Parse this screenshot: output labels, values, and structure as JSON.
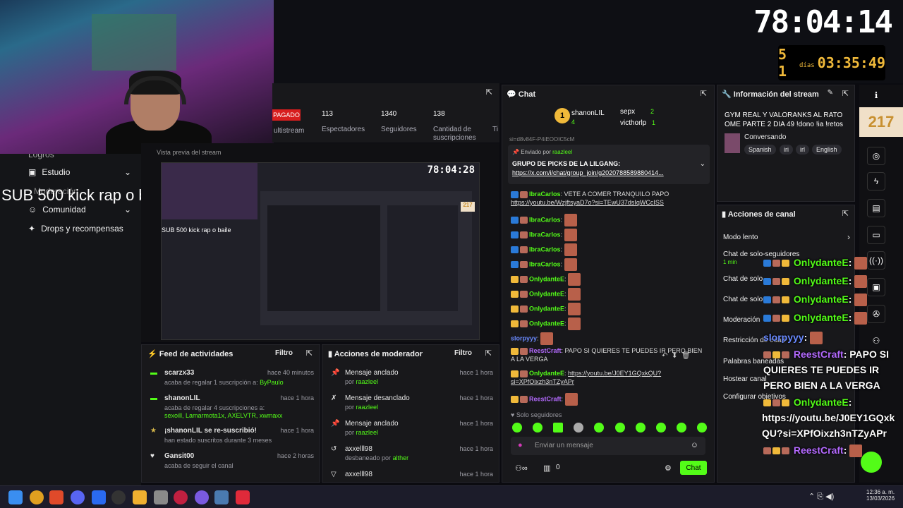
{
  "overlay": {
    "big_timer": "78:04:14",
    "days_number": "5 1",
    "days_label": "días",
    "day_timer": "03:35:49",
    "sub_count": "217",
    "sub_goal_text": "SUB 500 kick  rap o  baile"
  },
  "nav": {
    "items": [
      {
        "label": "Logros"
      },
      {
        "label": "Estudio"
      },
      {
        "label": "Moderación"
      },
      {
        "label": "Comunidad"
      },
      {
        "label": "Drops y recompensas"
      }
    ],
    "preview_label": "Vista previa del stream"
  },
  "stats": {
    "paid_badge": "PAGADO",
    "multistream": "ultistream",
    "viewers_value": "113",
    "viewers_label": "Espectadores",
    "followers_value": "1340",
    "followers_label": "Seguidores",
    "subs_value": "138",
    "subs_label": "Cantidad de suscripciones",
    "ti_label": "Ti"
  },
  "preview": {
    "timer": "78:04:28",
    "sub_text": "SUB 500 kick  rap o  baile"
  },
  "feed": {
    "title": "Feed de actividades",
    "filter": "Filtro",
    "rows": [
      {
        "user": "scarzx33",
        "time": "hace 40 minutos",
        "line": "acaba de regalar 1 suscripción a:",
        "extra": "ByPaulo"
      },
      {
        "user": "shanonLIL",
        "time": "hace 1 hora",
        "line": "acaba de regalar 4 suscripciones a:",
        "extra": "sexoill, Lamarmota1x, AXELVTR, xwmaxx"
      },
      {
        "user": "¡shanonLIL se re-suscribió!",
        "time": "hace 1 hora",
        "line": "han estado suscritos durante 3 meses",
        "extra": ""
      },
      {
        "user": "Gansit00",
        "time": "hace 2 horas",
        "line": "acaba de seguir el canal",
        "extra": ""
      }
    ]
  },
  "modactions": {
    "title": "Acciones de moderador",
    "filter": "Filtro",
    "rows": [
      {
        "action": "Mensaje anclado",
        "by": "por",
        "mod": "raazleel",
        "time": "hace 1 hora"
      },
      {
        "action": "Mensaje desanclado",
        "by": "por",
        "mod": "raazleel",
        "time": "hace 1 hora"
      },
      {
        "action": "Mensaje anclado",
        "by": "por",
        "mod": "raazleel",
        "time": "hace 1 hora"
      },
      {
        "action": "axxelll98",
        "by": "desbaneado por",
        "mod": "alther",
        "time": "hace 1 hora"
      },
      {
        "action": "axxelll98",
        "by": "",
        "mod": "",
        "time": "hace 1 hora"
      }
    ]
  },
  "chat": {
    "title": "Chat",
    "top_users": [
      {
        "name": "shanonLIL",
        "count": "4"
      },
      {
        "name": "sepx",
        "count": "2"
      },
      {
        "name": "victhorlp",
        "count": "1"
      }
    ],
    "partial_top": "si=d8v84F-P4iEOOIC5cM",
    "pinned_by_label": "Enviado por",
    "pinned_by_user": "raazleel",
    "pinned_text": "GRUPO DE PICKS DE LA LILGANG:",
    "pinned_link": "https://x.com/i/chat/group_join/g2020788589880414...",
    "messages": [
      {
        "user": "IbraCarlos",
        "text": ": VETE A COMER TRANQUILO PAPO",
        "link": "https://youtu.be/WzjftsyaD7o?si=TEwU37dsIqWCcISS"
      },
      {
        "user": "IbraCarlos",
        "text": ":"
      },
      {
        "user": "IbraCarlos",
        "text": ":"
      },
      {
        "user": "IbraCarlos",
        "text": ":"
      },
      {
        "user": "IbraCarlos",
        "text": ":"
      },
      {
        "user": "OnlydanteE",
        "text": ":"
      },
      {
        "user": "OnlydanteE",
        "text": ":"
      },
      {
        "user": "OnlydanteE",
        "text": ":"
      },
      {
        "user": "OnlydanteE",
        "text": ":"
      },
      {
        "user": "slorpyyy",
        "text": ":"
      },
      {
        "user": "ReestCraft",
        "text": ": PAPO SI QUIERES TE PUEDES IR PERO BIEN A LA VERGA"
      },
      {
        "user": "OnlydanteE",
        "text": ":",
        "link": "https://youtu.be/J0EY1GQxkQU?si=XPfOixzh3nTZyAPr"
      },
      {
        "user": "ReestCraft",
        "text": ":"
      }
    ],
    "followers_only": "Solo seguidores",
    "input_placeholder": "Enviar un mensaje",
    "points": "0",
    "send_label": "Chat"
  },
  "info": {
    "title": "Información del stream",
    "stream_title": "GYM REAL Y VALORANKS AL RATO OME PARTE 2 DIA 49 !dono !ia !retos",
    "category": "Conversando",
    "tags": [
      "Spanish",
      "iri",
      "irl",
      "English"
    ]
  },
  "canal": {
    "title": "Acciones de canal",
    "rows": [
      {
        "label": "Modo lento",
        "sub": ""
      },
      {
        "label": "Chat de solo-seguidores",
        "sub": "1 min"
      },
      {
        "label": "Chat de solo",
        "sub": ""
      },
      {
        "label": "Chat de solo",
        "sub": ""
      },
      {
        "label": "Moderación",
        "sub": ""
      },
      {
        "label": "Restricción de edad",
        "sub": ""
      },
      {
        "label": "Palabras baneadas",
        "sub": ""
      },
      {
        "label": "Hostear canal",
        "sub": ""
      },
      {
        "label": "Configurar objetivos",
        "sub": ""
      }
    ]
  },
  "overlay_chat": [
    {
      "user": "OnlydanteE",
      "text": ":"
    },
    {
      "user": "OnlydanteE",
      "text": ":"
    },
    {
      "user": "OnlydanteE",
      "text": ":"
    },
    {
      "user": "OnlydanteE",
      "text": ":"
    },
    {
      "user": "slorpyyy",
      "text": ":"
    },
    {
      "user": "ReestCraft",
      "text": ": PAPO SI"
    },
    {
      "user": "",
      "text": "QUIERES TE PUEDES IR"
    },
    {
      "user": "",
      "text": "PERO BIEN A LA VERGA"
    },
    {
      "user": "OnlydanteE",
      "text": ":"
    },
    {
      "user": "",
      "text": "https://youtu.be/J0EY1GQxk"
    },
    {
      "user": "",
      "text": "QU?si=XPfOixzh3nTZyAPr"
    },
    {
      "user": "ReestCraft",
      "text": ":"
    }
  ],
  "taskbar": {
    "time": "12:36 a. m.",
    "date": "13/03/2026"
  },
  "colors": {
    "kick_green": "#53fc18",
    "panel": "#18181b",
    "timer_amber": "#f0b93a"
  }
}
